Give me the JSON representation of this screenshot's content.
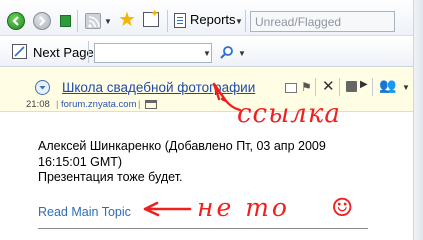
{
  "toolbar": {
    "reports_label": "Reports",
    "filter_value": "Unread/Flagged",
    "next_page_label": "Next Page",
    "search_value": ""
  },
  "topic": {
    "title": "Школа свадебной фотографии",
    "time": "21:08",
    "forum": "forum.znyata.com"
  },
  "message": {
    "author_line": "Алексей Шинкаренко (Добавлено Пт, 03 апр 2009 16:15:01 GMT)",
    "text": "Презентация тоже будет.",
    "read_main_link": "Read Main Topic"
  },
  "annotations": {
    "link_label": "ссылка",
    "not_that_label": "не то",
    "smiley": "☺"
  },
  "colors": {
    "accent_red": "#ef2020",
    "link_blue": "#1f4aa8",
    "header_band": "#fffde3"
  },
  "icons": [
    "back-icon",
    "forward-icon",
    "export-icon",
    "rss-icon",
    "favorite-star-icon",
    "new-item-icon",
    "reports-icon",
    "next-page-icon",
    "search-icon",
    "toggle-icon",
    "envelope-icon",
    "flag-icon",
    "close-icon",
    "print-icon",
    "move-icon",
    "people-icon"
  ]
}
